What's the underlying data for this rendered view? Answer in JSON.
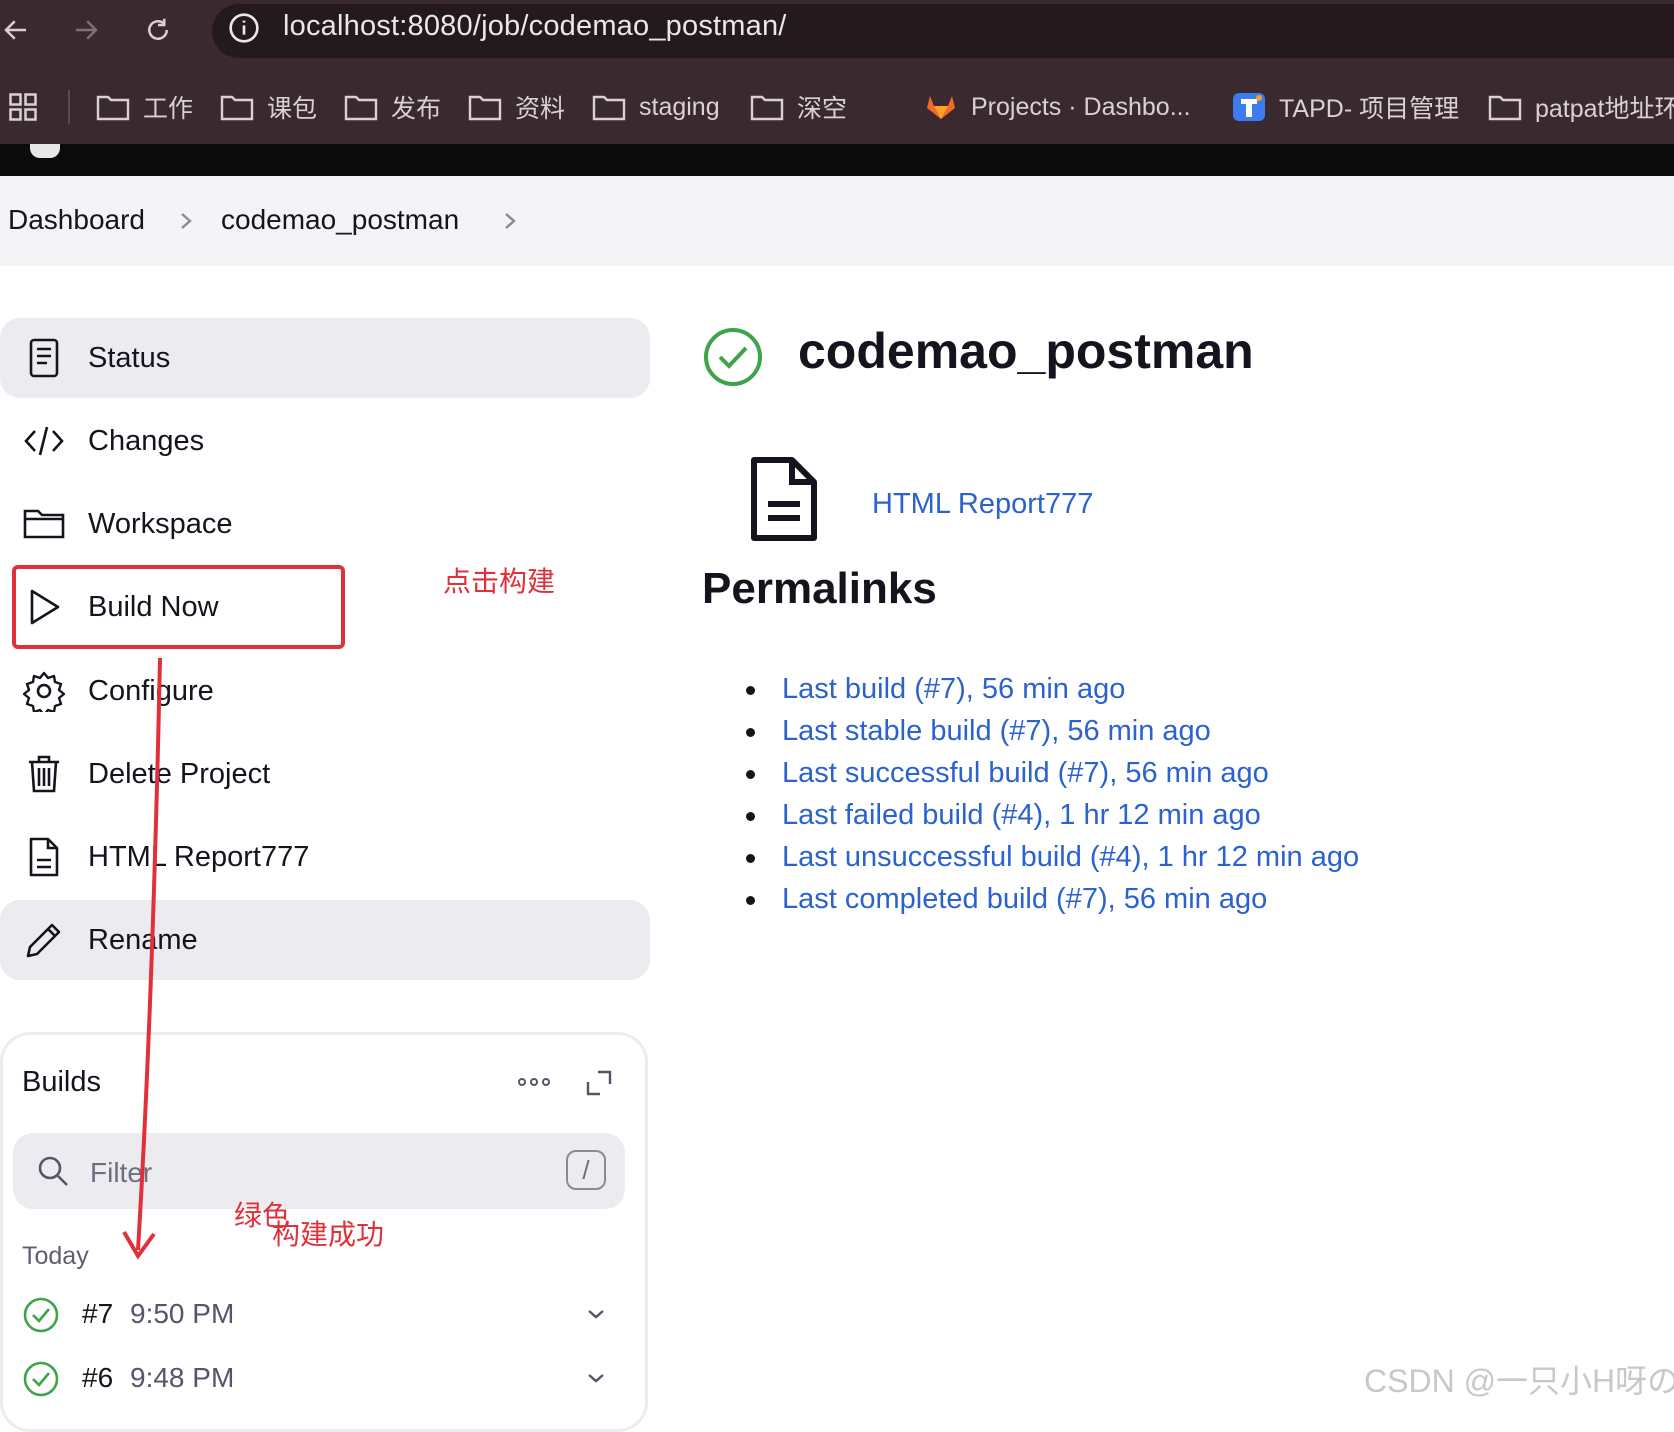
{
  "browser": {
    "url": "localhost:8080/job/codemao_postman/",
    "bookmarks": [
      {
        "label": "工作",
        "icon": "folder-icon"
      },
      {
        "label": "课包",
        "icon": "folder-icon"
      },
      {
        "label": "发布",
        "icon": "folder-icon"
      },
      {
        "label": "资料",
        "icon": "folder-icon"
      },
      {
        "label": "staging",
        "icon": "folder-icon"
      },
      {
        "label": "深空",
        "icon": "folder-icon"
      },
      {
        "label": "Projects · Dashbo...",
        "icon": "gitlab-icon"
      },
      {
        "label": "TAPD- 项目管理",
        "icon": "tapd-icon"
      },
      {
        "label": "patpat地址环",
        "icon": "folder-icon"
      }
    ]
  },
  "breadcrumb": {
    "items": [
      "Dashboard",
      "codemao_postman"
    ]
  },
  "sidebar": {
    "items": [
      {
        "label": "Status",
        "icon": "status-doc-icon",
        "active": true
      },
      {
        "label": "Changes",
        "icon": "code-icon"
      },
      {
        "label": "Workspace",
        "icon": "folder-icon"
      },
      {
        "label": "Build Now",
        "icon": "play-icon"
      },
      {
        "label": "Configure",
        "icon": "gear-icon"
      },
      {
        "label": "Delete Project",
        "icon": "trash-icon"
      },
      {
        "label": "HTML Report777",
        "icon": "document-icon"
      },
      {
        "label": "Rename",
        "icon": "pencil-icon",
        "hover": true
      }
    ]
  },
  "builds": {
    "title": "Builds",
    "filter_placeholder": "Filter",
    "shortcut_key": "/",
    "group_label": "Today",
    "items": [
      {
        "number": "#7",
        "time": "9:50 PM",
        "status": "success"
      },
      {
        "number": "#6",
        "time": "9:48 PM",
        "status": "success"
      }
    ]
  },
  "main": {
    "job_title": "codemao_postman",
    "status": "success",
    "report_link": "HTML Report777",
    "permalinks_heading": "Permalinks",
    "permalinks": [
      "Last build (#7), 56 min ago",
      "Last stable build (#7), 56 min ago",
      "Last successful build (#7), 56 min ago",
      "Last failed build (#4), 1 hr 12 min ago",
      "Last unsuccessful build (#4), 1 hr 12 min ago",
      "Last completed build (#7), 56 min ago"
    ]
  },
  "annotations": {
    "build_now_note": "点击构建",
    "green_note_line1": "绿色",
    "green_note_line2": "构建成功",
    "watermark": "CSDN @一只小H呀の"
  },
  "colors": {
    "accent_link": "#2b62d0",
    "success_green": "#3ea34a",
    "annotation_red": "#e0303a",
    "chrome_bg": "#3a2a30"
  }
}
